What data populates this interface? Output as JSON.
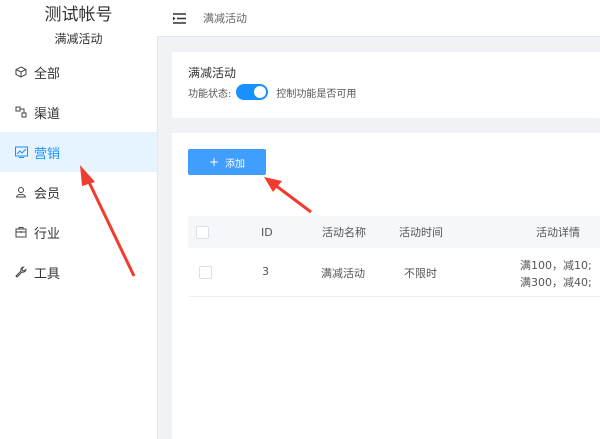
{
  "sidebar": {
    "account_name": "测试帐号",
    "account_sub": "满减活动",
    "items": [
      {
        "label": "全部",
        "icon": "cube-icon"
      },
      {
        "label": "渠道",
        "icon": "channel-icon"
      },
      {
        "label": "营销",
        "icon": "chart-icon",
        "active": true
      },
      {
        "label": "会员",
        "icon": "user-icon"
      },
      {
        "label": "行业",
        "icon": "briefcase-icon"
      },
      {
        "label": "工具",
        "icon": "wrench-icon"
      }
    ]
  },
  "topbar": {
    "breadcrumb": "满减活动"
  },
  "panel": {
    "title": "满减活动",
    "status_label": "功能状态:",
    "switch_on": true,
    "status_hint": "控制功能是否可用"
  },
  "toolbar": {
    "add_label": "添加"
  },
  "table": {
    "headers": [
      "ID",
      "活动名称",
      "活动时间",
      "活动详情"
    ],
    "rows": [
      {
        "id": "3",
        "name": "满减活动",
        "time": "不限时",
        "detail_line1": "满100，减10;",
        "detail_line2": "满300，减40;"
      }
    ]
  },
  "colors": {
    "accent": "#1890ff",
    "button": "#409eff",
    "annotation_arrow": "#f23b2f"
  }
}
